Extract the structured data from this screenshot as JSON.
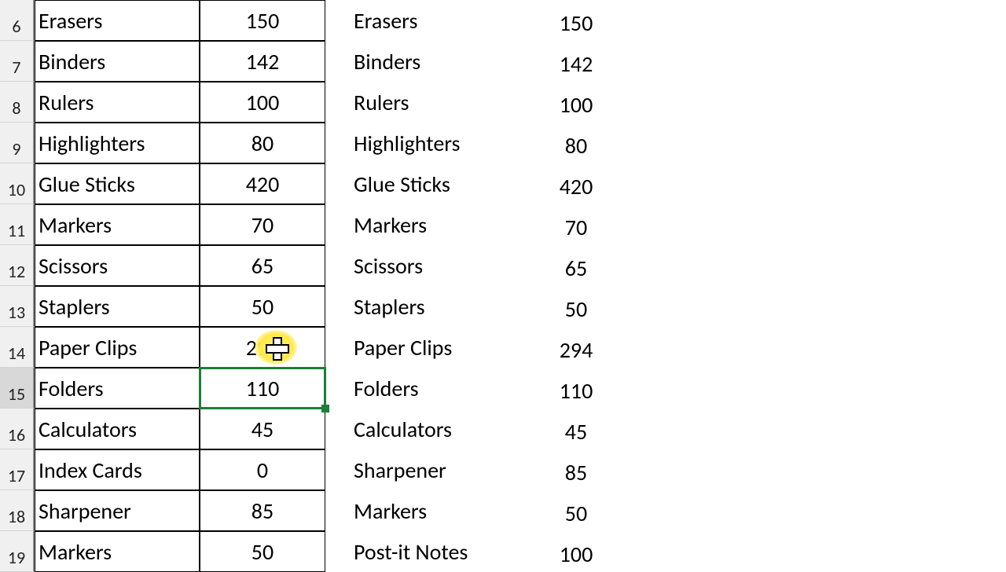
{
  "rows": [
    {
      "num": 6,
      "b": "Erasers",
      "c": "150",
      "d": "Erasers",
      "e": "150"
    },
    {
      "num": 7,
      "b": "Binders",
      "c": "142",
      "d": "Binders",
      "e": "142"
    },
    {
      "num": 8,
      "b": "Rulers",
      "c": "100",
      "d": "Rulers",
      "e": "100"
    },
    {
      "num": 9,
      "b": "Highlighters",
      "c": "80",
      "d": "Highlighters",
      "e": "80"
    },
    {
      "num": 10,
      "b": "Glue Sticks",
      "c": "420",
      "d": "Glue Sticks",
      "e": "420"
    },
    {
      "num": 11,
      "b": "Markers",
      "c": "70",
      "d": "Markers",
      "e": "70"
    },
    {
      "num": 12,
      "b": "Scissors",
      "c": "65",
      "d": "Scissors",
      "e": "65"
    },
    {
      "num": 13,
      "b": "Staplers",
      "c": "50",
      "d": "Staplers",
      "e": "50"
    },
    {
      "num": 14,
      "b": "Paper Clips",
      "c": "294",
      "d": "Paper Clips",
      "e": "294"
    },
    {
      "num": 15,
      "b": "Folders",
      "c": "110",
      "d": "Folders",
      "e": "110"
    },
    {
      "num": 16,
      "b": "Calculators",
      "c": "45",
      "d": "Calculators",
      "e": "45"
    },
    {
      "num": 17,
      "b": "Index Cards",
      "c": "0",
      "d": "Sharpener",
      "e": "85"
    },
    {
      "num": 18,
      "b": "Sharpener",
      "c": "85",
      "d": "Markers",
      "e": "50"
    },
    {
      "num": 19,
      "b": "Markers",
      "c": "50",
      "d": "Post-it Notes",
      "e": "100"
    }
  ],
  "selection": {
    "row_index": 9,
    "col": "c"
  },
  "cursor": {
    "over_row_index": 8,
    "over_col": "c"
  }
}
